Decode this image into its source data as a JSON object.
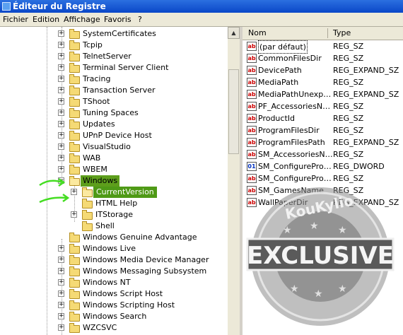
{
  "window": {
    "title": "Éditeur du Registre"
  },
  "menu": [
    "Fichier",
    "Edition",
    "Affichage",
    "Favoris",
    "?"
  ],
  "tree": [
    {
      "label": "SystemCertificates",
      "level": 0,
      "expander": "+"
    },
    {
      "label": "Tcpip",
      "level": 0,
      "expander": "+"
    },
    {
      "label": "TelnetServer",
      "level": 0,
      "expander": "+"
    },
    {
      "label": "Terminal Server Client",
      "level": 0,
      "expander": "+"
    },
    {
      "label": "Tracing",
      "level": 0,
      "expander": "+"
    },
    {
      "label": "Transaction Server",
      "level": 0,
      "expander": "+"
    },
    {
      "label": "TShoot",
      "level": 0,
      "expander": "+"
    },
    {
      "label": "Tuning Spaces",
      "level": 0,
      "expander": "+"
    },
    {
      "label": "Updates",
      "level": 0,
      "expander": "+"
    },
    {
      "label": "UPnP Device Host",
      "level": 0,
      "expander": "+"
    },
    {
      "label": "VisualStudio",
      "level": 0,
      "expander": "+"
    },
    {
      "label": "WAB",
      "level": 0,
      "expander": "+"
    },
    {
      "label": "WBEM",
      "level": 0,
      "expander": "+"
    },
    {
      "label": "Windows",
      "level": 0,
      "expander": "-"
    },
    {
      "label": "CurrentVersion",
      "level": 1,
      "expander": "+"
    },
    {
      "label": "HTML Help",
      "level": 1,
      "expander": ""
    },
    {
      "label": "ITStorage",
      "level": 1,
      "expander": "+"
    },
    {
      "label": "Shell",
      "level": 1,
      "expander": ""
    },
    {
      "label": "Windows Genuine Advantage",
      "level": 0,
      "expander": ""
    },
    {
      "label": "Windows Live",
      "level": 0,
      "expander": "+"
    },
    {
      "label": "Windows Media Device Manager",
      "level": 0,
      "expander": "+"
    },
    {
      "label": "Windows Messaging Subsystem",
      "level": 0,
      "expander": "+"
    },
    {
      "label": "Windows NT",
      "level": 0,
      "expander": "+"
    },
    {
      "label": "Windows Script Host",
      "level": 0,
      "expander": "+"
    },
    {
      "label": "Windows Scripting Host",
      "level": 0,
      "expander": "+"
    },
    {
      "label": "Windows Search",
      "level": 0,
      "expander": "+"
    },
    {
      "label": "WZCSVC",
      "level": 0,
      "expander": "+"
    }
  ],
  "values_header": {
    "name": "Nom",
    "type": "Type"
  },
  "values": [
    {
      "name": "(par défaut)",
      "type": "REG_SZ",
      "icon": "ab"
    },
    {
      "name": "CommonFilesDir",
      "type": "REG_SZ",
      "icon": "ab"
    },
    {
      "name": "DevicePath",
      "type": "REG_EXPAND_SZ",
      "icon": "ab"
    },
    {
      "name": "MediaPath",
      "type": "REG_SZ",
      "icon": "ab"
    },
    {
      "name": "MediaPathUnexp…",
      "type": "REG_EXPAND_SZ",
      "icon": "ab"
    },
    {
      "name": "PF_AccessoriesN…",
      "type": "REG_SZ",
      "icon": "ab"
    },
    {
      "name": "ProductId",
      "type": "REG_SZ",
      "icon": "ab"
    },
    {
      "name": "ProgramFilesDir",
      "type": "REG_SZ",
      "icon": "ab"
    },
    {
      "name": "ProgramFilesPath",
      "type": "REG_EXPAND_SZ",
      "icon": "ab"
    },
    {
      "name": "SM_AccessoriesN…",
      "type": "REG_SZ",
      "icon": "ab"
    },
    {
      "name": "SM_ConfigurePro…",
      "type": "REG_DWORD",
      "icon": "dword"
    },
    {
      "name": "SM_ConfigurePro…",
      "type": "REG_SZ",
      "icon": "ab"
    },
    {
      "name": "SM_GamesName",
      "type": "REG_SZ",
      "icon": "ab"
    },
    {
      "name": "WallPaperDir",
      "type": "REG_EXPAND_SZ",
      "icon": "ab"
    }
  ],
  "watermark": {
    "top_text": "KouKylio",
    "main_text": "EXCLUSIVE"
  },
  "colors": {
    "highlight": "#5d9e1c",
    "arrow": "#44dd22",
    "titlebar": "#0a47c8"
  }
}
